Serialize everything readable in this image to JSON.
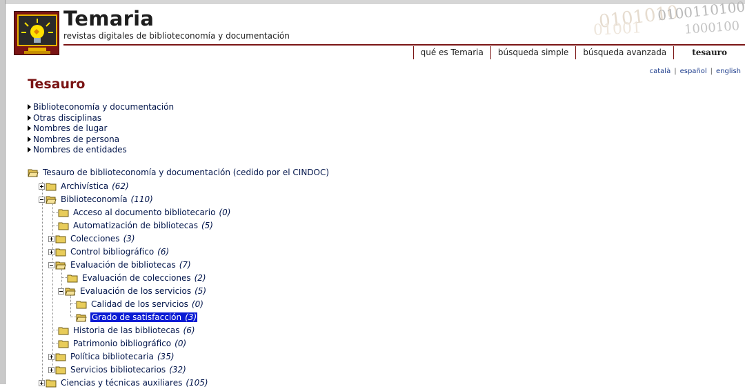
{
  "brand": {
    "title": "Temaria",
    "subtitle": "revistas digitales de biblioteconomía y documentación",
    "binary_lines": [
      "0100110100",
      "0101010",
      "1000100",
      "01001"
    ]
  },
  "nav": {
    "items": [
      {
        "label": "qué es Temaria",
        "active": false
      },
      {
        "label": "búsqueda simple",
        "active": false
      },
      {
        "label": "búsqueda avanzada",
        "active": false
      },
      {
        "label": "tesauro",
        "active": true
      }
    ]
  },
  "languages": {
    "items": [
      "català",
      "español",
      "english"
    ],
    "separator": "|"
  },
  "page_title": "Tesauro",
  "categories": [
    "Biblioteconomía y documentación",
    "Otras disciplinas",
    "Nombres de lugar",
    "Nombres de persona",
    "Nombres de entidades"
  ],
  "tree": {
    "root": {
      "label": "Tesauro de biblioteconomía y documentación (cedido por el CINDOC)"
    },
    "nodes": [
      {
        "label": "Archivística",
        "count": "(62)",
        "expander": "plus"
      },
      {
        "label": "Biblioteconomía",
        "count": "(110)",
        "expander": "minus"
      },
      {
        "label": "Acceso al documento bibliotecario",
        "count": "(0)",
        "expander": "none"
      },
      {
        "label": "Automatización de bibliotecas",
        "count": "(5)",
        "expander": "none"
      },
      {
        "label": "Colecciones",
        "count": "(3)",
        "expander": "plus"
      },
      {
        "label": "Control bibliográfico",
        "count": "(6)",
        "expander": "plus"
      },
      {
        "label": "Evaluación de bibliotecas",
        "count": "(7)",
        "expander": "minus"
      },
      {
        "label": "Evaluación de colecciones",
        "count": "(2)",
        "expander": "none"
      },
      {
        "label": "Evaluación de los servicios",
        "count": "(5)",
        "expander": "minus"
      },
      {
        "label": "Calidad de los servicios",
        "count": "(0)",
        "expander": "none"
      },
      {
        "label": "Grado de satisfacción",
        "count": "(3)",
        "expander": "none",
        "selected": true
      },
      {
        "label": "Historia de las bibliotecas",
        "count": "(6)",
        "expander": "none"
      },
      {
        "label": "Patrimonio bibliográfico",
        "count": "(0)",
        "expander": "none"
      },
      {
        "label": "Política bibliotecaria",
        "count": "(35)",
        "expander": "plus"
      },
      {
        "label": "Servicios bibliotecarios",
        "count": "(32)",
        "expander": "plus"
      },
      {
        "label": "Ciencias y técnicas auxiliares",
        "count": "(105)",
        "expander": "plus"
      }
    ]
  },
  "colors": {
    "brand_red": "#7a1414",
    "link_navy": "#00144a",
    "selection_blue": "#0a1bd4"
  },
  "icons": {
    "folder": "folder-icon",
    "folder_open": "folder-open-icon",
    "expand": "plus-box-icon",
    "collapse": "minus-box-icon",
    "bullet": "triangle-right-icon",
    "logo": "lightbulb-monitor-logo"
  }
}
